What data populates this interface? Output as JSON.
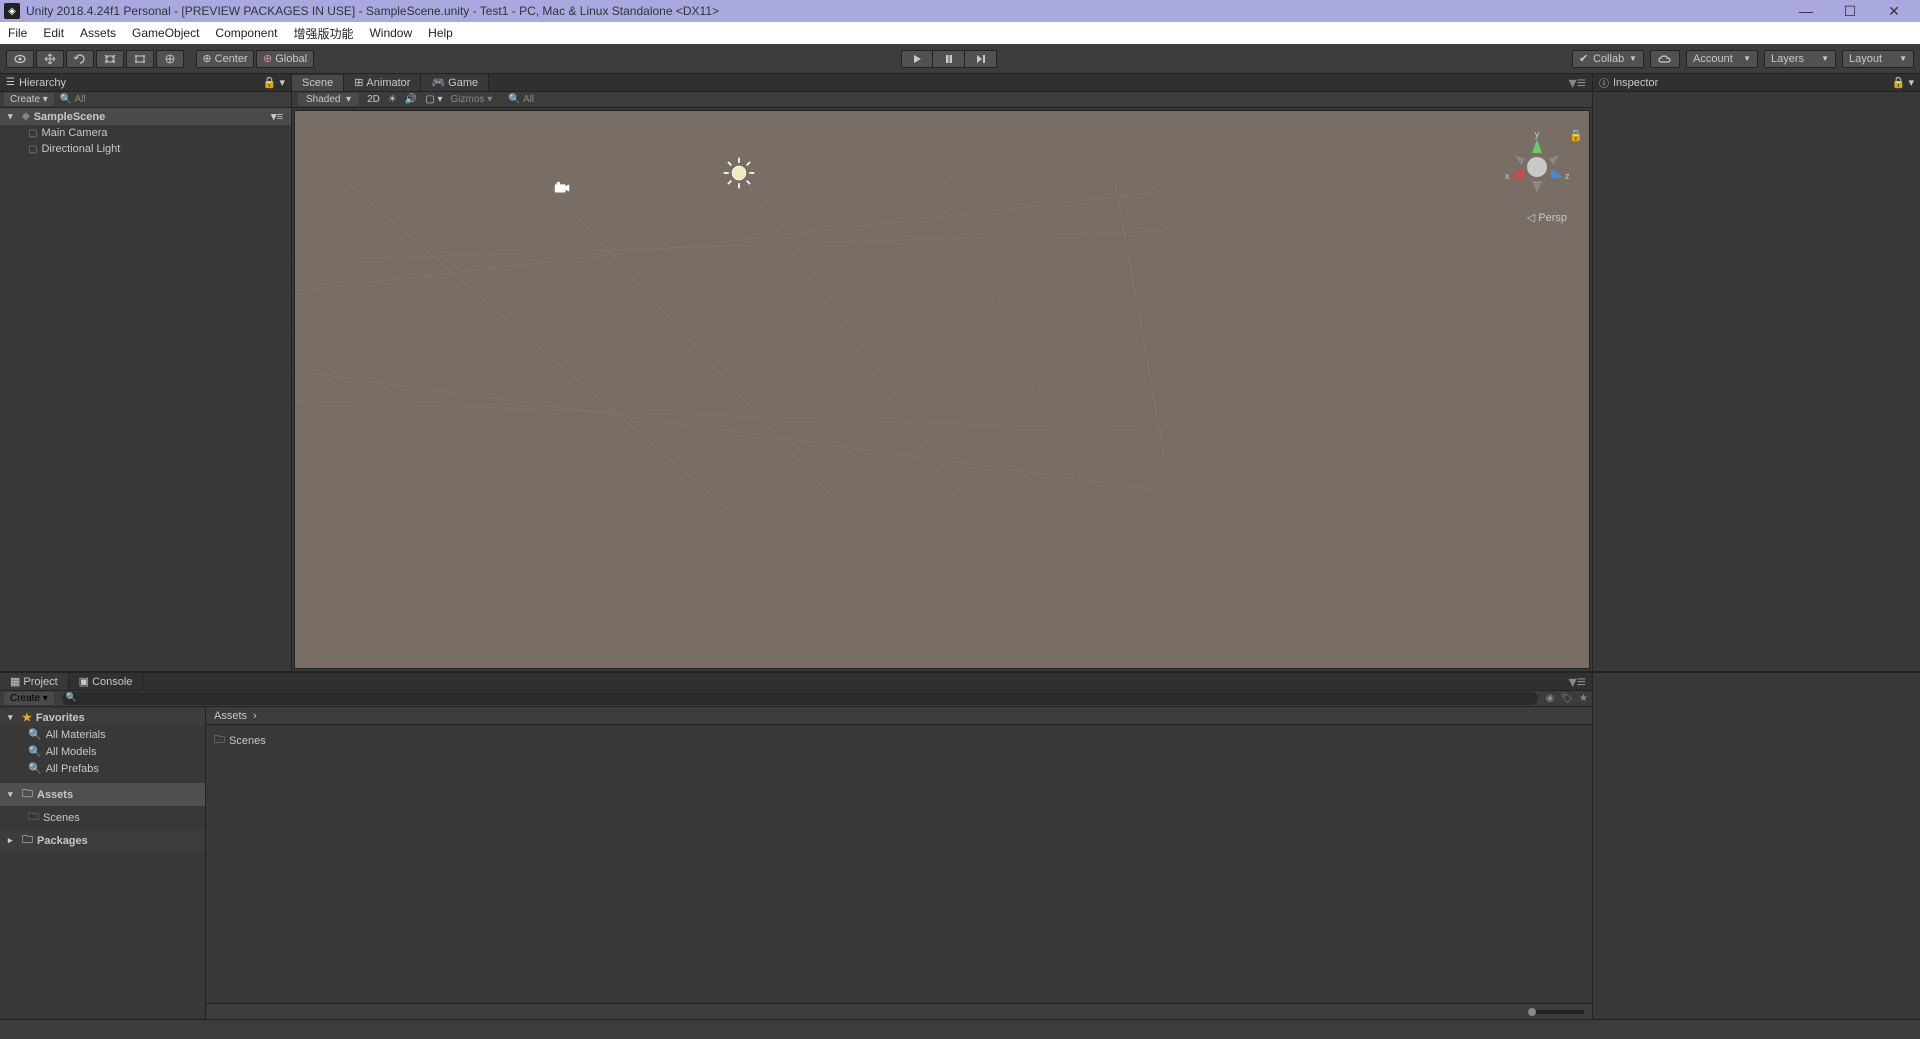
{
  "titlebar": {
    "text": "Unity 2018.4.24f1 Personal - [PREVIEW PACKAGES IN USE] - SampleScene.unity - Test1 - PC, Mac & Linux Standalone <DX11>"
  },
  "menubar": {
    "items": [
      "File",
      "Edit",
      "Assets",
      "GameObject",
      "Component",
      "增强版功能",
      "Window",
      "Help"
    ]
  },
  "toolbar": {
    "pivot": "Center",
    "handle": "Global",
    "collab": "Collab",
    "account": "Account",
    "layers": "Layers",
    "layout": "Layout"
  },
  "hierarchy": {
    "title": "Hierarchy",
    "create": "Create",
    "search_placeholder": "All",
    "scene": "SampleScene",
    "items": [
      "Main Camera",
      "Directional Light"
    ]
  },
  "scene_tabs": {
    "scene": "Scene",
    "animator": "Animator",
    "game": "Game"
  },
  "scene_toolbar": {
    "shaded": "Shaded",
    "twoD": "2D",
    "gizmos": "Gizmos",
    "search_placeholder": "All"
  },
  "scene_view": {
    "persp": "Persp",
    "axes": {
      "x": "x",
      "y": "y",
      "z": "z"
    }
  },
  "inspector": {
    "title": "Inspector"
  },
  "project": {
    "tabs": {
      "project": "Project",
      "console": "Console"
    },
    "create": "Create",
    "favorites": "Favorites",
    "fav_items": [
      "All Materials",
      "All Models",
      "All Prefabs"
    ],
    "assets": "Assets",
    "scenes": "Scenes",
    "packages": "Packages",
    "breadcrumb": "Assets",
    "content_items": [
      "Scenes"
    ]
  }
}
